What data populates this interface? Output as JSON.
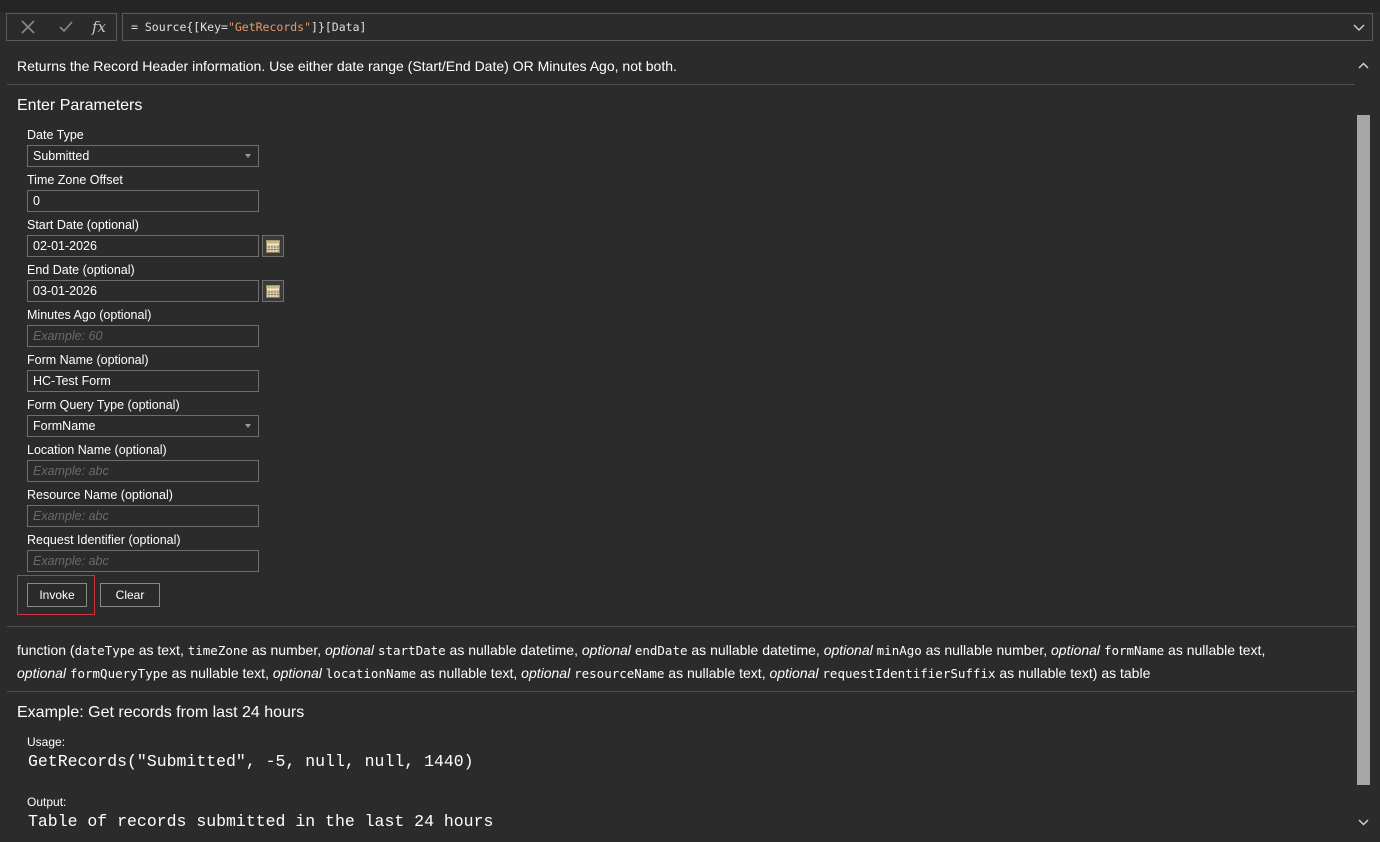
{
  "formula_bar": {
    "cancel_icon": "close-icon",
    "confirm_icon": "check-icon",
    "fx_label": "fx",
    "formula_prefix": "= Source{[Key=",
    "formula_string": "\"GetRecords\"",
    "formula_suffix": "]}[Data]"
  },
  "description": "Returns the Record Header information. Use either date range (Start/End Date) OR Minutes Ago, not both.",
  "parameters": {
    "title": "Enter Parameters",
    "date_type": {
      "label": "Date Type",
      "value": "Submitted"
    },
    "time_zone": {
      "label": "Time Zone Offset",
      "value": "0"
    },
    "start_date": {
      "label": "Start Date (optional)",
      "value": "02-01-2026"
    },
    "end_date": {
      "label": "End Date (optional)",
      "value": "03-01-2026"
    },
    "minutes_ago": {
      "label": "Minutes Ago (optional)",
      "value": "",
      "placeholder": "Example: 60"
    },
    "form_name": {
      "label": "Form Name (optional)",
      "value": "HC-Test Form"
    },
    "form_query_type": {
      "label": "Form Query Type (optional)",
      "value": "FormName"
    },
    "location_name": {
      "label": "Location Name (optional)",
      "value": "",
      "placeholder": "Example: abc"
    },
    "resource_name": {
      "label": "Resource Name (optional)",
      "value": "",
      "placeholder": "Example: abc"
    },
    "request_identifier": {
      "label": "Request Identifier (optional)",
      "value": "",
      "placeholder": "Example: abc"
    },
    "invoke_label": "Invoke",
    "clear_label": "Clear"
  },
  "signature": {
    "s0": "function (",
    "p_dateType": "dateType",
    "s1": " as text, ",
    "p_timeZone": "timeZone",
    "s2": " as number, ",
    "opt1": "optional",
    "p_startDate": "startDate",
    "s3": " as nullable datetime, ",
    "opt2": "optional",
    "p_endDate": "endDate",
    "s4": " as nullable datetime, ",
    "opt3": "optional",
    "p_minAgo": "minAgo",
    "s5": " as nullable number, ",
    "opt4": "optional",
    "p_formName": "formName",
    "s6": " as nullable text,",
    "opt5": "optional",
    "p_formQueryType": "formQueryType",
    "s7": " as nullable text, ",
    "opt6": "optional",
    "p_locationName": "locationName",
    "s8": " as nullable text, ",
    "opt7": "optional",
    "p_resourceName": "resourceName",
    "s9": " as nullable text, ",
    "opt8": "optional",
    "p_requestIdentifierSuffix": "requestIdentifierSuffix",
    "s10": " as nullable text) as table"
  },
  "example": {
    "title": "Example: Get records from last 24 hours",
    "usage_label": "Usage:",
    "usage_code": "GetRecords(\"Submitted\", -5, null, null, 1440)",
    "output_label": "Output:",
    "output_text": "Table of records submitted in the last 24 hours"
  },
  "colors": {
    "background": "#2b2b2b",
    "border": "#6e6e6e",
    "highlight": "#d13438",
    "string_literal": "#e79a6a"
  }
}
